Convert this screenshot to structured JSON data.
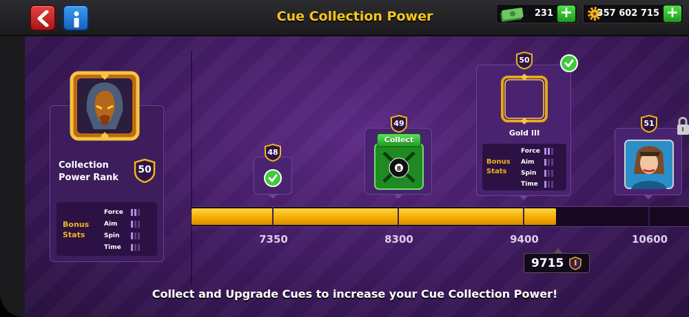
{
  "header": {
    "title": "Cue Collection Power",
    "back_icon": "back-arrow-icon",
    "info_icon": "info-icon",
    "cash": "231",
    "coins": "357 602 715",
    "accent": "#f5c519"
  },
  "rank": {
    "label_line1": "Collection",
    "label_line2": "Power Rank",
    "level": "50",
    "bonus_title_1": "Bonus",
    "bonus_title_2": "Stats",
    "stats": [
      "Force",
      "Aim",
      "Spin",
      "Time"
    ]
  },
  "nodes": [
    {
      "level": "48",
      "state": "collected"
    },
    {
      "level": "49",
      "state": "collectable",
      "button": "Collect"
    },
    {
      "level": "50",
      "state": "collected",
      "name": "Gold III",
      "bonus_title_1": "Bonus",
      "bonus_title_2": "Stats",
      "stats": [
        "Force",
        "Aim",
        "Spin",
        "Time"
      ]
    },
    {
      "level": "51",
      "state": "locked"
    }
  ],
  "progress": {
    "ticks": [
      "7350",
      "8300",
      "9400",
      "10600"
    ],
    "current": "9715",
    "fill_fraction": 0.733
  },
  "footer": "Collect and Upgrade Cues to increase your Cue Collection Power!"
}
